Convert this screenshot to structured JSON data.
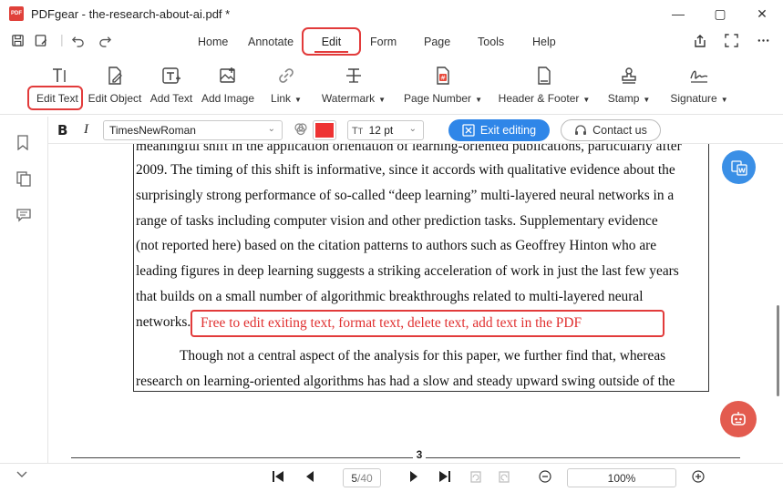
{
  "window": {
    "title": "PDFgear - the-research-about-ai.pdf *",
    "logo_text": "PDF",
    "minimize_icon": "—",
    "maximize_icon": "▢",
    "close_icon": "✕"
  },
  "menu": {
    "items": [
      "Home",
      "Annotate",
      "Edit",
      "Form",
      "Page",
      "Tools",
      "Help"
    ],
    "active": "Edit"
  },
  "toolbar": {
    "tools": [
      {
        "label": "Edit Text",
        "icon": "edit-text-icon"
      },
      {
        "label": "Edit Object",
        "icon": "edit-object-icon"
      },
      {
        "label": "Add Text",
        "icon": "add-text-icon"
      },
      {
        "label": "Add Image",
        "icon": "add-image-icon"
      },
      {
        "label": "Link",
        "icon": "link-icon",
        "dropdown": true
      },
      {
        "label": "Watermark",
        "icon": "watermark-icon",
        "dropdown": true
      },
      {
        "label": "Page Number",
        "icon": "page-number-icon",
        "dropdown": true
      },
      {
        "label": "Header & Footer",
        "icon": "header-footer-icon",
        "dropdown": true
      },
      {
        "label": "Stamp",
        "icon": "stamp-icon",
        "dropdown": true
      },
      {
        "label": "Signature",
        "icon": "signature-icon",
        "dropdown": true
      }
    ]
  },
  "format": {
    "bold": "B",
    "italic": "I",
    "font": "TimesNewRoman",
    "color": "#ee3333",
    "size": "12 pt",
    "exit_label": "Exit editing",
    "contact_label": "Contact us"
  },
  "document": {
    "lines": [
      "meaningful shift in the application orientation of learning-oriented publications, particularly after",
      "2009.  The timing of this shift is informative, since it accords with qualitative evidence about the",
      "surprisingly strong performance of so-called “deep learning” multi-layered neural networks in a",
      "range of tasks including computer vision and other prediction tasks.  Supplementary evidence",
      "(not reported here) based on the citation patterns to authors such as Geoffrey Hinton who are",
      "leading figures in deep learning suggests a striking acceleration of work in just the last few years",
      "that builds on a small number of algorithmic breakthroughs related to multi-layered neural",
      "networks."
    ],
    "added_text": "Free to edit exiting text, format text, delete text, add text in the PDF",
    "paragraph2": [
      "Though not a central aspect of the analysis for this paper, we further find that, whereas",
      "research on learning-oriented algorithms has had a slow and steady upward swing outside of the"
    ],
    "page_footer_number": "3"
  },
  "navigation": {
    "current_page": "5",
    "total_pages": "/40",
    "zoom": "100%"
  }
}
